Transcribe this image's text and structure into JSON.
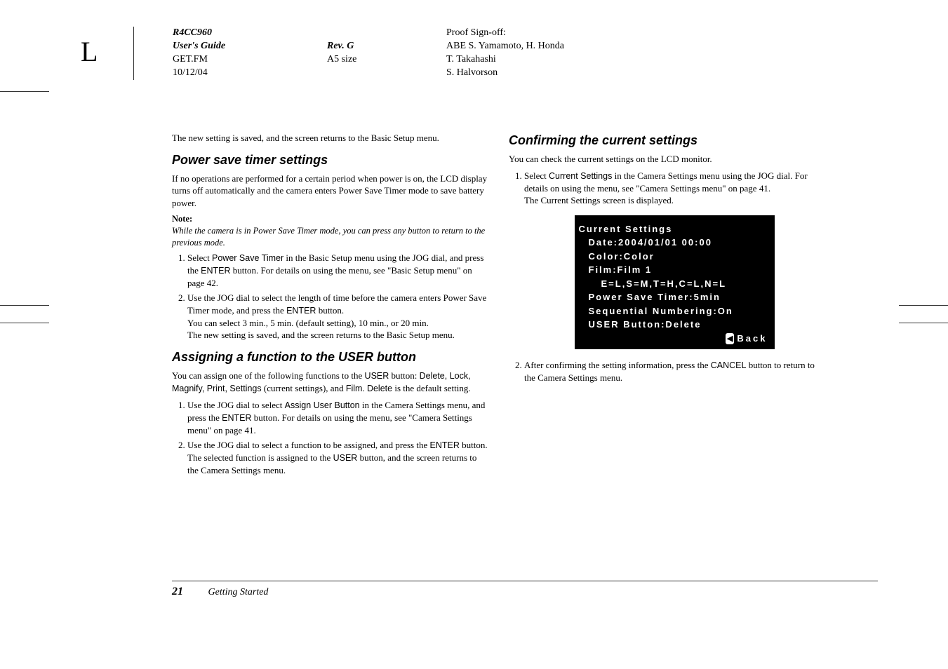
{
  "crop_mark": "L",
  "header": {
    "doc_code": "R4CC960",
    "doc_title": "User's Guide",
    "filename": "GET.FM",
    "date": "10/12/04",
    "revision": "Rev. G",
    "paper_size": "A5 size",
    "signoff_label": "Proof Sign-off:",
    "signoff_1": "ABE S. Yamamoto, H. Honda",
    "signoff_2": "T. Takahashi",
    "signoff_3": "S. Halvorson"
  },
  "left_col": {
    "intro": "The new setting is saved, and the screen returns to the Basic Setup menu.",
    "h_power": "Power save timer settings",
    "power_intro": "If no operations are performed for a certain period when power is on, the LCD display turns off automatically and the camera enters Power Save Timer mode to save battery power.",
    "note_label": "Note:",
    "note_body": "While the camera is in Power Save Timer mode, you can press any button to return to the previous mode.",
    "power_step1_a": "Select ",
    "power_step1_pst": "Power Save Timer",
    "power_step1_b": " in the Basic Setup menu using the JOG dial, and press the ",
    "power_step1_enter": "ENTER",
    "power_step1_c": " button. For details on using the menu, see \"Basic Setup menu\" on page 42.",
    "power_step2_a": "Use the JOG dial to select the length of time before the camera enters Power Save Timer mode, and press the ",
    "power_step2_enter": "ENTER",
    "power_step2_b": " button.",
    "power_step2_opts": "You can select 3 min., 5 min. (default setting), 10 min., or 20 min.",
    "power_step2_end": "The new setting is saved, and the screen returns to the Basic Setup menu.",
    "h_assign": "Assigning a function to the USER button",
    "assign_intro_a": "You can assign one of the following functions to the ",
    "assign_user": "USER",
    "assign_intro_b": " button: ",
    "assign_list": "Delete, Lock, Magnify, Print, Settings",
    "assign_intro_c": " (current settings), and ",
    "assign_film": "Film",
    "assign_intro_d": ". ",
    "assign_delete": "Delete",
    "assign_intro_e": " is the default setting.",
    "assign_step1_a": "Use the JOG dial to select ",
    "assign_step1_aub": "Assign User Button",
    "assign_step1_b": " in the Camera Settings menu, and press the ",
    "assign_step1_enter": "ENTER",
    "assign_step1_c": " button. For details on using the menu, see \"Camera Settings menu\" on page 41.",
    "assign_step2_a": "Use the JOG dial to select a function to be assigned, and press the ",
    "assign_step2_enter": "ENTER",
    "assign_step2_b": " button.",
    "assign_step2_end_a": "The selected function is assigned to the ",
    "assign_step2_end_user": "USER",
    "assign_step2_end_b": " button, and the screen returns to the Camera Settings menu."
  },
  "right_col": {
    "h_confirm": "Confirming the current settings",
    "confirm_intro": "You can check the current settings on the LCD monitor.",
    "confirm_step1_a": "Select ",
    "confirm_step1_cs": "Current Settings",
    "confirm_step1_b": " in the Camera Settings menu using the JOG dial. For details on using the menu, see \"Camera Settings menu\" on page 41.",
    "confirm_step1_result": "The Current Settings screen is displayed.",
    "lcd": {
      "title": "Current Settings",
      "date": "Date:2004/01/01 00:00",
      "color": "Color:Color",
      "film": "Film:Film 1",
      "params": "E=L,S=M,T=H,C=L,N=L",
      "power": "Power Save Timer:5min",
      "seq": "Sequential Numbering:On",
      "user": "USER Button:Delete",
      "back_icon": "◀",
      "back": "Back"
    },
    "confirm_step2_a": "After confirming the setting information, press the ",
    "confirm_step2_cancel": "CANCEL",
    "confirm_step2_b": " button to return to the Camera Settings menu."
  },
  "footer": {
    "page": "21",
    "section": "Getting Started"
  }
}
